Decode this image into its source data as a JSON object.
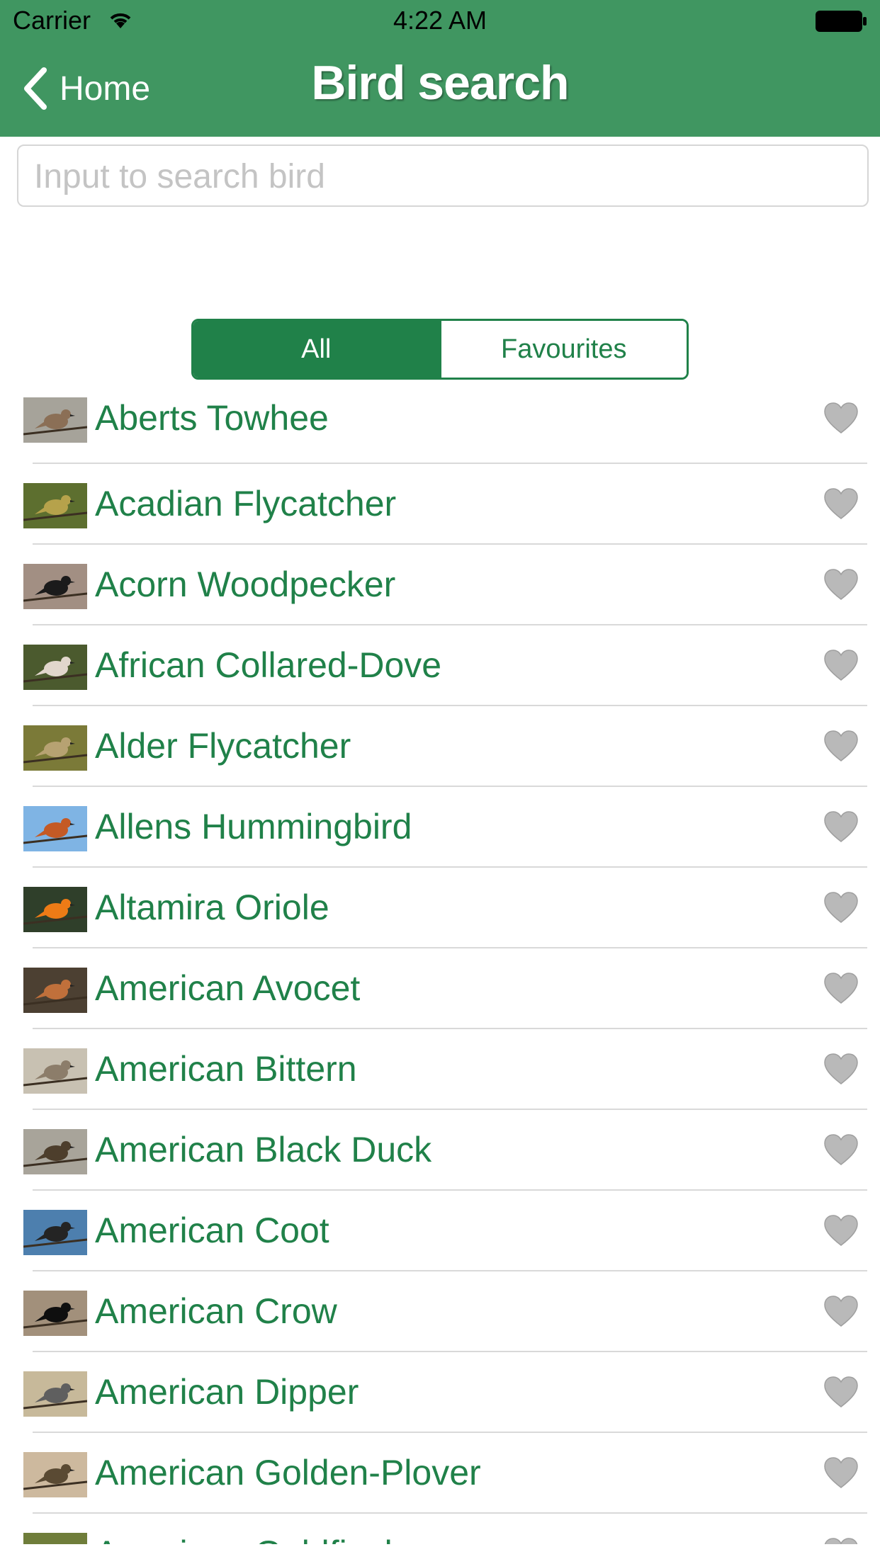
{
  "status_bar": {
    "carrier": "Carrier",
    "time": "4:22 AM"
  },
  "nav": {
    "back_label": "Home",
    "title": "Bird search"
  },
  "search": {
    "placeholder": "Input to search bird",
    "value": ""
  },
  "segments": {
    "all_label": "All",
    "favourites_label": "Favourites",
    "selected": "All"
  },
  "colors": {
    "header_bg": "#409661",
    "accent": "#208149",
    "heart": "#b9b9b9"
  },
  "birds": [
    {
      "name": "Aberts Towhee",
      "thumb_color": "#8b6f56",
      "sky": "#a6a39a"
    },
    {
      "name": "Acadian Flycatcher",
      "thumb_color": "#b6a24b",
      "sky": "#5d6f2f"
    },
    {
      "name": "Acorn Woodpecker",
      "thumb_color": "#1b1b1b",
      "sky": "#a28f83"
    },
    {
      "name": "African Collared-Dove",
      "thumb_color": "#e1d6cc",
      "sky": "#4b5a2e"
    },
    {
      "name": "Alder Flycatcher",
      "thumb_color": "#b7a272",
      "sky": "#7b7a38"
    },
    {
      "name": "Allens Hummingbird",
      "thumb_color": "#c45a25",
      "sky": "#7fb4e4"
    },
    {
      "name": "Altamira Oriole",
      "thumb_color": "#ed7b16",
      "sky": "#2f3f2a"
    },
    {
      "name": "American Avocet",
      "thumb_color": "#c0703b",
      "sky": "#4c4032"
    },
    {
      "name": "American Bittern",
      "thumb_color": "#8c7d6a",
      "sky": "#c8c1b2"
    },
    {
      "name": "American Black Duck",
      "thumb_color": "#4d3e2c",
      "sky": "#a8a49a"
    },
    {
      "name": "American Coot",
      "thumb_color": "#242424",
      "sky": "#4d7fae"
    },
    {
      "name": "American Crow",
      "thumb_color": "#0f0f0f",
      "sky": "#a2907b"
    },
    {
      "name": "American Dipper",
      "thumb_color": "#5f5f5f",
      "sky": "#c7b99a"
    },
    {
      "name": "American Golden-Plover",
      "thumb_color": "#5a4a33",
      "sky": "#cdb99e"
    },
    {
      "name": "American Goldfinch",
      "thumb_color": "#d4c125",
      "sky": "#6f7d3a"
    }
  ]
}
